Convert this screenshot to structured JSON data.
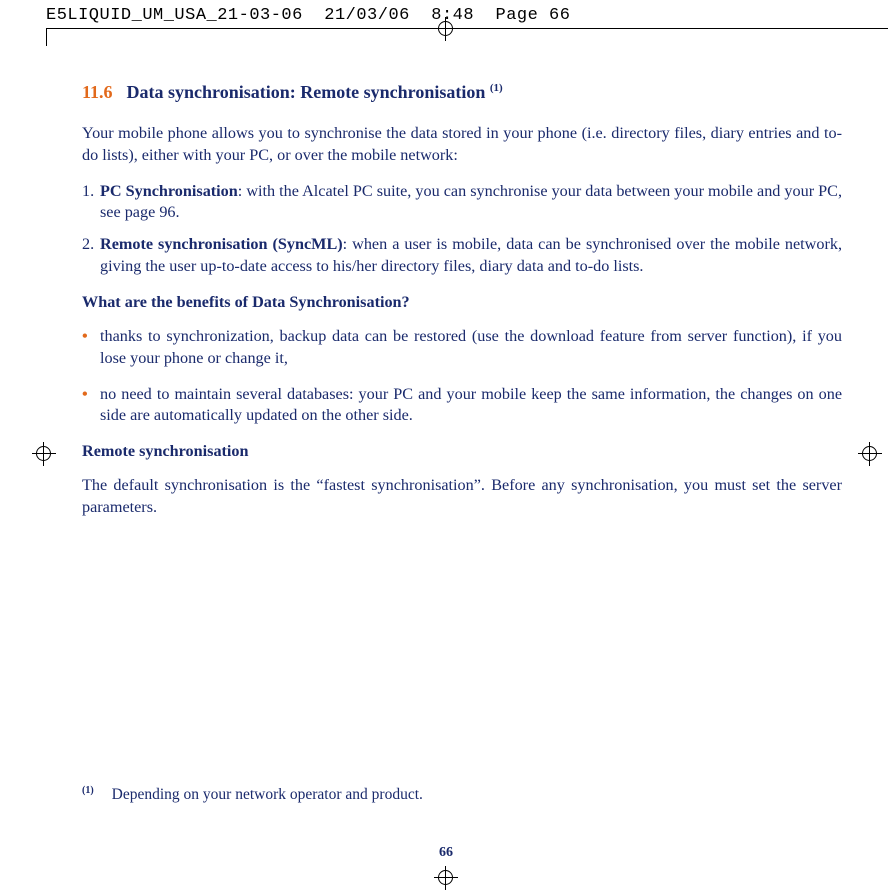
{
  "header": {
    "filename": "E5LIQUID_UM_USA_21-03-06",
    "date": "21/03/06",
    "time": "8:48",
    "pagelabel": "Page 66"
  },
  "section": {
    "number": "11.6",
    "title": "Data synchronisation: Remote synchronisation",
    "superscript": "(1)"
  },
  "intro": "Your mobile phone allows you to synchronise the data stored in your phone (i.e. directory files, diary entries and to-do lists), either with your PC, or over the mobile network:",
  "numbered": [
    {
      "n": "1.",
      "bold": "PC Synchronisation",
      "rest": ": with the Alcatel PC suite, you can synchronise your data between your mobile and your PC, see page 96."
    },
    {
      "n": "2.",
      "bold": "Remote synchronisation (SyncML)",
      "rest": ": when a user is mobile, data can be synchronised over the mobile network, giving the user up-to-date access to his/her directory files, diary data and to-do lists."
    }
  ],
  "benefits_heading": "What are the benefits of Data Synchronisation?",
  "bullets": [
    "thanks to synchronization, backup data can be restored (use the download feature from server function), if you lose your phone or change it,",
    "no need to maintain several databases: your PC and your mobile keep the same information, the changes on one side are automatically updated on the other side."
  ],
  "remote_heading": "Remote synchronisation",
  "remote_para": "The default synchronisation is the “fastest synchronisation”. Before any synchronisation, you must set the server parameters.",
  "footnote": {
    "mark": "(1)",
    "text": "Depending on your network operator and product."
  },
  "page_number": "66"
}
